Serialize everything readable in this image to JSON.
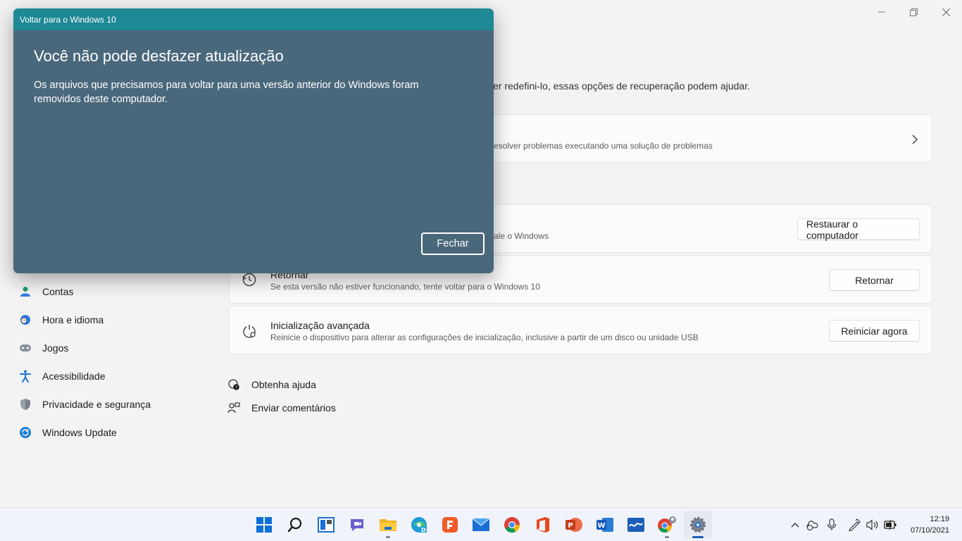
{
  "dialog": {
    "title": "Voltar para o Windows 10",
    "heading": "Você não pode desfazer atualização",
    "body": "Os arquivos que precisamos para voltar para uma versão anterior do Windows foram removidos deste computador.",
    "close_label": "Fechar"
  },
  "settings": {
    "page_description_partial": "er redefini-lo, essas opções de recuperação podem ajudar.",
    "troubleshoot_card": {
      "subtitle_partial": "esolver problemas executando uma solução de problemas"
    },
    "reset_card": {
      "subtitle_partial": "ale o Windows",
      "button": "Restaurar o computador"
    },
    "goback_card": {
      "title": "Retornar",
      "subtitle": "Se esta versão não estiver funcionando, tente voltar para o Windows 10",
      "button": "Retornar"
    },
    "advanced_card": {
      "title": "Inicialização avançada",
      "subtitle": "Reinicie o dispositivo para alterar as configurações de inicialização, inclusive a partir de um disco ou unidade USB",
      "button": "Reiniciar agora"
    },
    "help_links": [
      {
        "label": "Obtenha ajuda",
        "icon": "help-icon"
      },
      {
        "label": "Enviar comentários",
        "icon": "feedback-icon"
      }
    ]
  },
  "sidebar": {
    "items": [
      {
        "label": "Contas",
        "icon": "accounts-icon"
      },
      {
        "label": "Hora e idioma",
        "icon": "time-language-icon"
      },
      {
        "label": "Jogos",
        "icon": "gaming-icon"
      },
      {
        "label": "Acessibilidade",
        "icon": "accessibility-icon"
      },
      {
        "label": "Privacidade e segurança",
        "icon": "privacy-shield-icon"
      },
      {
        "label": "Windows Update",
        "icon": "windows-update-icon"
      }
    ]
  },
  "taskbar": {
    "apps": [
      "start",
      "search",
      "task-view",
      "teams-chat",
      "file-explorer",
      "edge",
      "app-red",
      "mail",
      "chrome",
      "office",
      "powerpoint",
      "word",
      "whiteboard",
      "chrome-profile",
      "settings"
    ],
    "time": "12:19",
    "date": "07/10/2021"
  },
  "colors": {
    "dialog_bg": "#4a687c",
    "dialog_titlebar": "#1e8895",
    "accent": "#1b5fb5"
  }
}
